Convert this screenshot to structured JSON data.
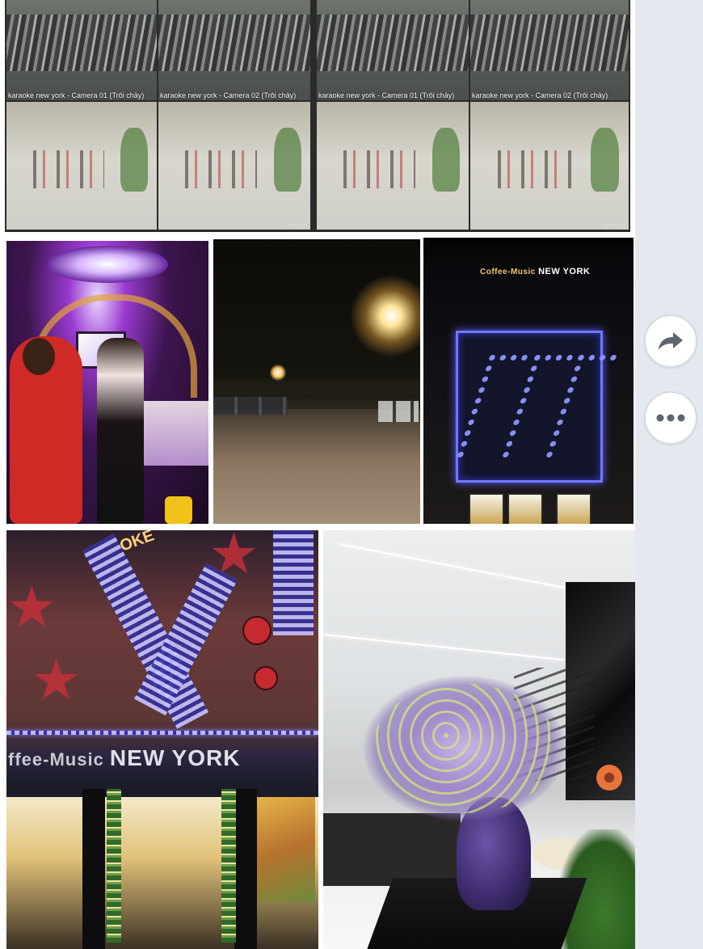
{
  "cctv_cameras": [
    {
      "label": "karaoke new york - Camera 01 (Trôi chảy)",
      "scene": "lot"
    },
    {
      "label": "karaoke new york - Camera 02 (Trôi chảy)",
      "scene": "lot"
    },
    {
      "label": "karaoke new york - Camera 01 (Trôi chảy)",
      "scene": "lot"
    },
    {
      "label": "karaoke new york - Camera 02 (Trôi chảy)",
      "scene": "lot"
    },
    {
      "label": "",
      "scene": "hall",
      "tag": ""
    },
    {
      "label": "",
      "scene": "hall",
      "tag": "Camera 04"
    },
    {
      "label": "",
      "scene": "hall",
      "tag": ""
    },
    {
      "label": "",
      "scene": "hall",
      "tag": "Camera 04"
    }
  ],
  "building_sign": {
    "small": "Coffee-Music",
    "big": "NEW YORK"
  },
  "entrance_sign": {
    "small": "ffee-Music",
    "big": "NEW YORK",
    "vertical": "OKE"
  },
  "actions": {
    "share_icon": "share-arrow-icon",
    "more_icon": "more-dots-icon"
  },
  "colors": {
    "side_bg": "#e4e9f0",
    "neon": "#6f78ff"
  }
}
